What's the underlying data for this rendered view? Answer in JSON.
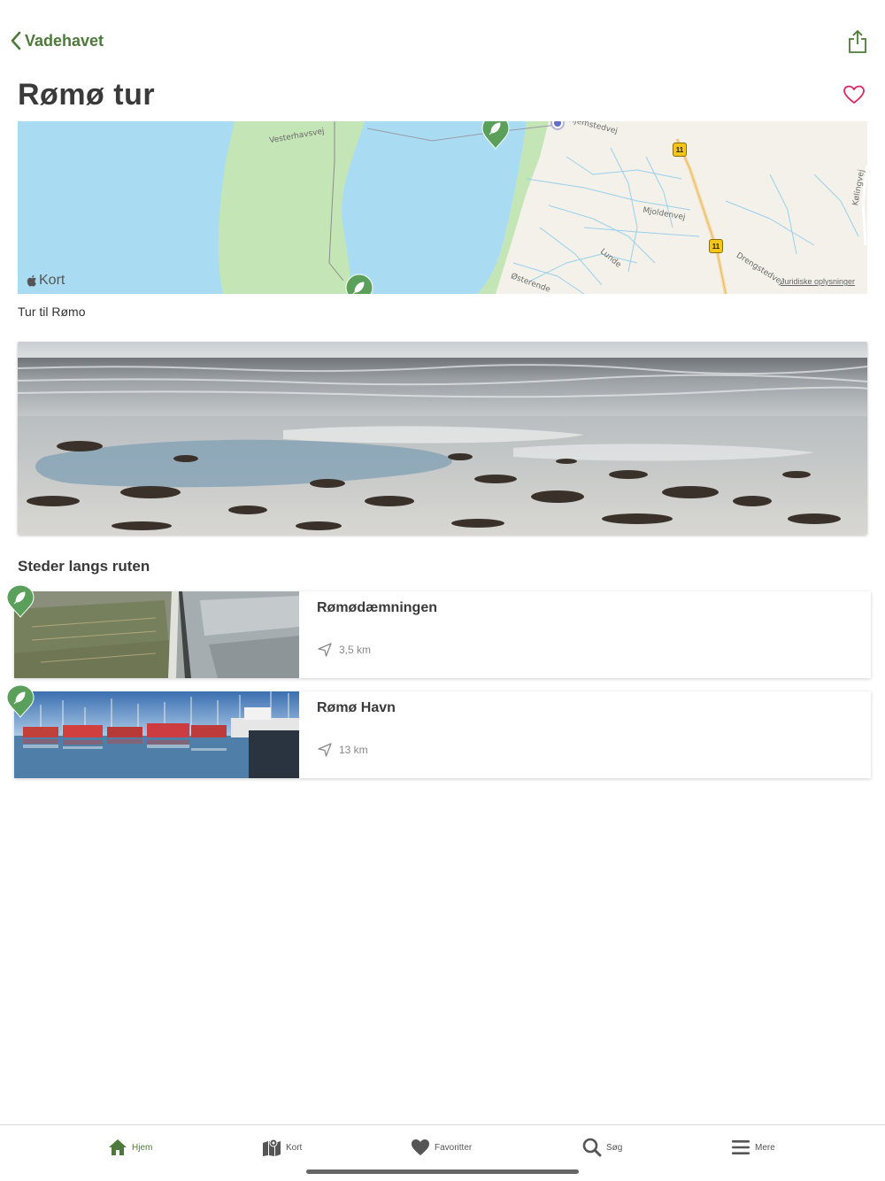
{
  "colors": {
    "accent": "#4d7a3a",
    "heart": "#d9275f",
    "pin": "#5aa05a"
  },
  "nav": {
    "back_label": "Vadehavet",
    "back_icon": "chevron-left-icon",
    "share_icon": "share-icon"
  },
  "page": {
    "title": "Rømø tur",
    "favorite_icon": "heart-outline-icon"
  },
  "map": {
    "logo_label": "Kort",
    "legal_label": "Juridiske oplysninger",
    "streets": [
      "Vesterhavsvej",
      "Hjemstedvej",
      "Mjoldenvej",
      "Lunde",
      "Drengstedvej",
      "Østerende",
      "Kølingvej"
    ],
    "road_number": "11"
  },
  "map_caption": "Tur til Rømo",
  "section_title": "Steder langs ruten",
  "places": [
    {
      "title": "Rømødæmningen",
      "distance": "3,5 km"
    },
    {
      "title": "Rømø Havn",
      "distance": "13 km"
    }
  ],
  "tabbar": {
    "tabs": [
      {
        "label": "Hjem",
        "icon": "home-icon",
        "active": true
      },
      {
        "label": "Kort",
        "icon": "map-icon",
        "active": false
      },
      {
        "label": "Favoritter",
        "icon": "heart-icon",
        "active": false
      },
      {
        "label": "Søg",
        "icon": "search-icon",
        "active": false
      },
      {
        "label": "Mere",
        "icon": "menu-icon",
        "active": false
      }
    ]
  }
}
